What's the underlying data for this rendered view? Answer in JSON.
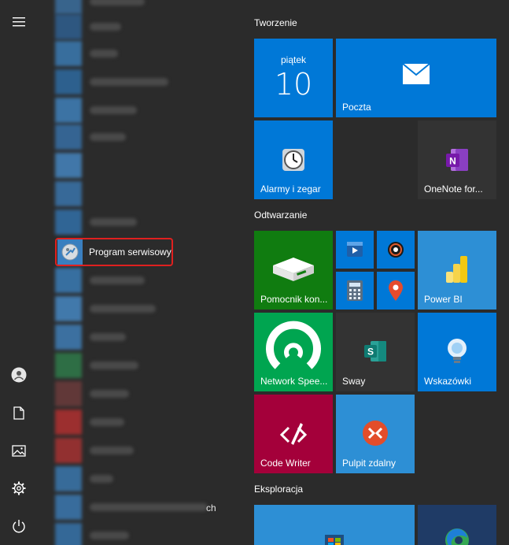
{
  "applist": {
    "selected_item": {
      "label": "Program serwisowy",
      "icon": "service-program-icon"
    },
    "partial_visible_text": "ch"
  },
  "rail": {
    "menu_icon": "hamburger-icon",
    "items": [
      "user-icon",
      "documents-icon",
      "pictures-icon",
      "settings-icon",
      "power-icon"
    ]
  },
  "groups": {
    "tworzenie": "Tworzenie",
    "odtwarzanie": "Odtwarzanie",
    "eksploracja": "Eksploracja"
  },
  "tiles": {
    "calendar": {
      "day_name": "piątek",
      "day_number": "10",
      "color": "#0078d7"
    },
    "mail": {
      "label": "Poczta",
      "color": "#0078d7"
    },
    "alarms": {
      "label": "Alarmy i zegar",
      "color": "#0078d7"
    },
    "onenote": {
      "label": "OneNote for...",
      "color": "#333333"
    },
    "pomocnik": {
      "label": "Pomocnik kon...",
      "color": "#107c10"
    },
    "movies": {
      "icon": "movies-icon",
      "color": "#0078d7"
    },
    "groove": {
      "icon": "groove-music-icon",
      "color": "#0078d7"
    },
    "calculator": {
      "icon": "calculator-icon",
      "color": "#0078d7"
    },
    "maps": {
      "icon": "maps-icon",
      "color": "#0078d7"
    },
    "powerbi": {
      "label": "Power BI",
      "color": "#2d8fd5"
    },
    "networkspeed": {
      "label": "Network Spee...",
      "color": "#00a550"
    },
    "sway": {
      "label": "Sway",
      "color": "#333333"
    },
    "wskazowki": {
      "label": "Wskazówki",
      "color": "#0078d7"
    },
    "codewriter": {
      "label": "Code Writer",
      "color": "#a4003a"
    },
    "pulpit": {
      "label": "Pulpit zdalny",
      "color": "#2d8fd5"
    },
    "store": {
      "color": "#2d8fd5"
    },
    "edge": {
      "color": "#1f3b66"
    }
  }
}
